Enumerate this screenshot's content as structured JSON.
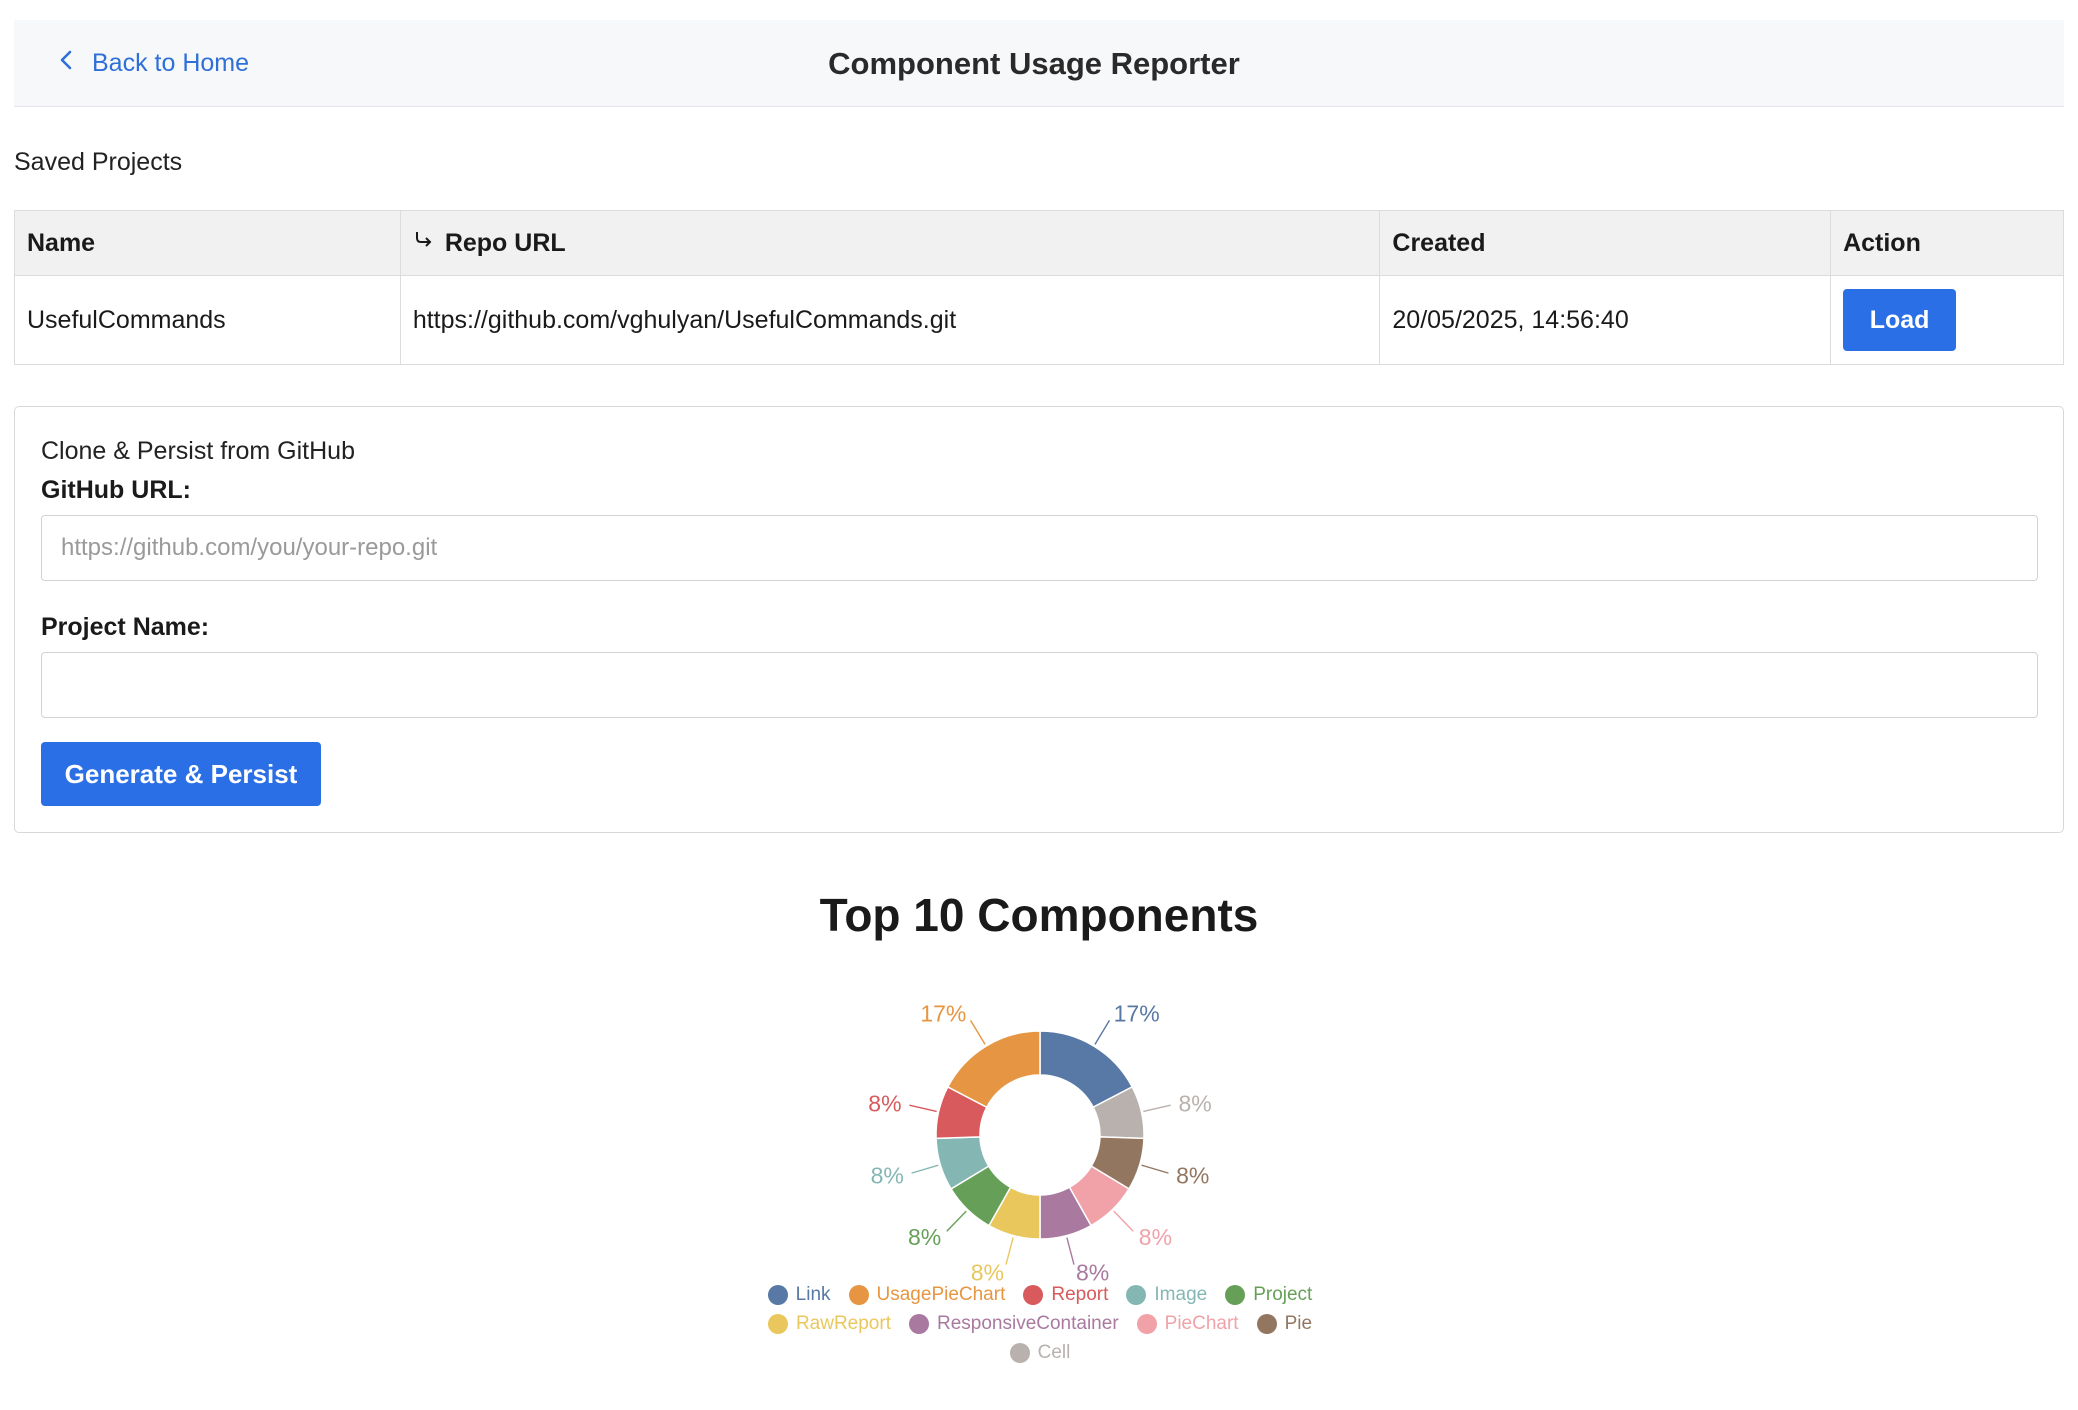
{
  "header": {
    "back_label": "Back to Home",
    "title": "Component Usage Reporter"
  },
  "saved_projects": {
    "label": "Saved Projects",
    "columns": {
      "name": "Name",
      "repo_url": "Repo URL",
      "created": "Created",
      "action": "Action"
    },
    "rows": [
      {
        "name": "UsefulCommands",
        "repo_url": "https://github.com/vghulyan/UsefulCommands.git",
        "created": "20/05/2025, 14:56:40",
        "action_label": "Load"
      }
    ]
  },
  "clone_form": {
    "title": "Clone & Persist from GitHub",
    "github_url_label": "GitHub URL:",
    "github_url_placeholder": "https://github.com/you/your-repo.git",
    "github_url_value": "",
    "project_name_label": "Project Name:",
    "project_name_value": "",
    "submit_label": "Generate & Persist"
  },
  "chart_data": {
    "type": "pie",
    "title": "Top 10 Components",
    "donut": true,
    "slices": [
      {
        "label": "Link",
        "percent": 17,
        "color": "#5878a6"
      },
      {
        "label": "Cell",
        "percent": 8,
        "color": "#b9b1ad"
      },
      {
        "label": "Pie",
        "percent": 8,
        "color": "#927660"
      },
      {
        "label": "PieChart",
        "percent": 8,
        "color": "#f0a2a8"
      },
      {
        "label": "ResponsiveContainer",
        "percent": 8,
        "color": "#a9799f"
      },
      {
        "label": "RawReport",
        "percent": 8,
        "color": "#e9c75d"
      },
      {
        "label": "Project",
        "percent": 8,
        "color": "#66a058"
      },
      {
        "label": "Image",
        "percent": 8,
        "color": "#84b7b3"
      },
      {
        "label": "Report",
        "percent": 8,
        "color": "#d85a5c"
      },
      {
        "label": "UsagePieChart",
        "percent": 17,
        "color": "#e69642"
      }
    ],
    "legend_order": [
      "Link",
      "UsagePieChart",
      "Report",
      "Image",
      "Project",
      "RawReport",
      "ResponsiveContainer",
      "PieChart",
      "Pie",
      "Cell"
    ],
    "legend_placement": "bottom"
  }
}
